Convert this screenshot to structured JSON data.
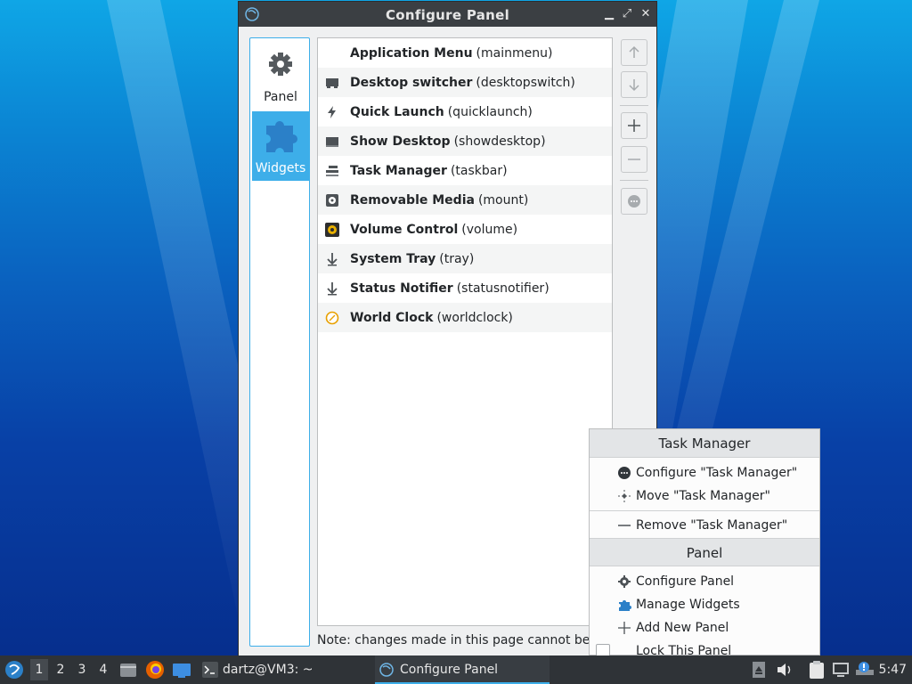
{
  "window": {
    "title": "Configure Panel",
    "sidebar": [
      {
        "label": "Panel",
        "icon": "gear-icon"
      },
      {
        "label": "Widgets",
        "icon": "puzzle-icon",
        "active": true
      }
    ],
    "widgets": [
      {
        "name": "Application Menu",
        "id": "(mainmenu)",
        "icon": "none"
      },
      {
        "name": "Desktop switcher",
        "id": "(desktopswitch)",
        "icon": "desktop-switcher-icon"
      },
      {
        "name": "Quick Launch",
        "id": "(quicklaunch)",
        "icon": "lightning-icon"
      },
      {
        "name": "Show Desktop",
        "id": "(showdesktop)",
        "icon": "show-desktop-icon"
      },
      {
        "name": "Task Manager",
        "id": "(taskbar)",
        "icon": "task-manager-icon"
      },
      {
        "name": "Removable Media",
        "id": "(mount)",
        "icon": "removable-media-icon"
      },
      {
        "name": "Volume Control",
        "id": "(volume)",
        "icon": "volume-icon"
      },
      {
        "name": "System Tray",
        "id": "(tray)",
        "icon": "tray-arrow-icon"
      },
      {
        "name": "Status Notifier",
        "id": "(statusnotifier)",
        "icon": "tray-arrow-icon"
      },
      {
        "name": "World Clock",
        "id": "(worldclock)",
        "icon": "clock-icon"
      }
    ],
    "note": "Note: changes made in this page cannot be re"
  },
  "context_menu": {
    "section1_title": "Task Manager",
    "configure": "Configure \"Task Manager\"",
    "move": "Move \"Task Manager\"",
    "remove": "Remove \"Task Manager\"",
    "section2_title": "Panel",
    "configure_panel": "Configure Panel",
    "manage_widgets": "Manage Widgets",
    "add_new_panel": "Add New Panel",
    "lock_panel": "Lock This Panel"
  },
  "taskbar": {
    "workspaces": [
      "1",
      "2",
      "3",
      "4"
    ],
    "terminal_task": "dartz@VM3: ~",
    "window_task": "Configure Panel",
    "clock": "5:47"
  },
  "colors": {
    "accent": "#3daee9",
    "titlebar": "#3b3f43",
    "taskbar": "#2f3337"
  }
}
